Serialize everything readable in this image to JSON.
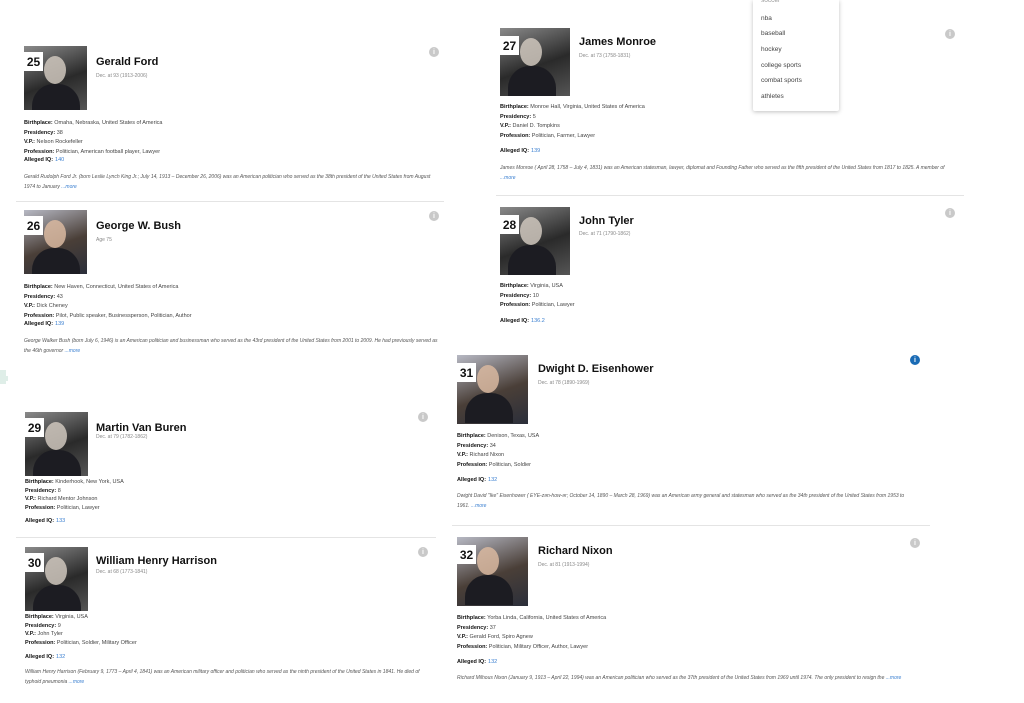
{
  "more_label": "...more",
  "dropdown": {
    "items": [
      "soccer",
      "nba",
      "baseball",
      "hockey",
      "college sports",
      "combat sports",
      "athletes"
    ]
  },
  "presidents": [
    {
      "number": "25",
      "name": "Gerald Ford",
      "dates": "Dec. at 93 (1913-2006)",
      "birthplace": "Omaha, Nebraska, United States of America",
      "presidency": "38",
      "vp": "Nelson Rockefeller",
      "profession": "Politician, American football player, Lawyer",
      "iq": "140",
      "bio": "Gerald Rudolph Ford Jr. (born Leslie Lynch King Jr.; July 14, 1913 – December 26, 2006) was an American politician who served as the 38th president of the United States from August 1974 to January"
    },
    {
      "number": "26",
      "name": "George W. Bush",
      "dates": "Age 75",
      "birthplace": "New Haven, Connecticut, United States of America",
      "presidency": "43",
      "vp": "Dick Cheney",
      "profession": "Pilot, Public speaker, Businessperson, Politician, Author",
      "iq": "139",
      "bio": "George Walker Bush (born July 6, 1946) is an American politician and businessman who served as the 43rd president of the United States from 2001 to 2009. He had previously served as the 46th governor"
    },
    {
      "number": "27",
      "name": "James Monroe",
      "dates": "Dec. at 73 (1758-1831)",
      "birthplace": "Monroe Hall, Virginia, United States of America",
      "presidency": "5",
      "vp": "Daniel D. Tompkins",
      "profession": "Politician, Farmer, Lawyer",
      "iq": "139",
      "bio": "James Monroe ( April 28, 1758 – July 4, 1831) was an American statesman, lawyer, diplomat and Founding Father who served as the fifth president of the United States from 1817 to 1825. A member of"
    },
    {
      "number": "28",
      "name": "John Tyler",
      "dates": "Dec. at 71 (1790-1862)",
      "birthplace": "Virginia, USA",
      "presidency": "10",
      "profession": "Politician, Lawyer",
      "iq": "136.2"
    },
    {
      "number": "29",
      "name": "Martin Van Buren",
      "dates": "Dec. at 79 (1782-1862)",
      "birthplace": "Kinderhook, New York, USA",
      "presidency": "8",
      "vp": "Richard Mentor Johnson",
      "profession": "Politician, Lawyer",
      "iq": "133"
    },
    {
      "number": "30",
      "name": "William Henry Harrison",
      "dates": "Dec. at 68 (1773-1841)",
      "birthplace": "Virginia, USA",
      "presidency": "9",
      "vp": "John Tyler",
      "profession": "Politician, Soldier, Military Officer",
      "iq": "132",
      "bio": "William Henry Harrison (February 9, 1773 – April 4, 1841) was an American military officer and politician who served as the ninth president of the United States in 1841. He died of typhoid pneumonia"
    },
    {
      "number": "31",
      "name": "Dwight D. Eisenhower",
      "dates": "Dec. at 78 (1890-1969)",
      "birthplace": "Denison, Texas, USA",
      "presidency": "34",
      "vp": "Richard Nixon",
      "profession": "Politician, Soldier",
      "iq": "132",
      "bio": "Dwight David \"Ike\" Eisenhower ( EYE-zən-how-ər; October 14, 1890 – March 28, 1969) was an American army general and statesman who served as the 34th president of the United States from 1953 to 1961."
    },
    {
      "number": "32",
      "name": "Richard Nixon",
      "dates": "Dec. at 81 (1913-1994)",
      "birthplace": "Yorba Linda, California, United States of America",
      "presidency": "37",
      "vp": "Gerald Ford, Spiro Agnew",
      "profession": "Politician, Military Officer, Author, Lawyer",
      "iq": "132",
      "bio": "Richard Milhous Nixon (January 9, 1913 – April 22, 1994) was an American politician who served as the 37th president of the United States from 1969 until 1974. The only president to resign the"
    }
  ],
  "labels": {
    "birthplace": "Birthplace:",
    "presidency": "Presidency:",
    "vp": "V.P.:",
    "profession": "Profession:",
    "iq": "Alleged IQ:"
  },
  "colors": {
    "link": "#3a7fd0",
    "info_active": "#1a6bb5",
    "info_inactive": "#c9c9c9"
  },
  "icons": {
    "info": "info-circle-icon"
  }
}
